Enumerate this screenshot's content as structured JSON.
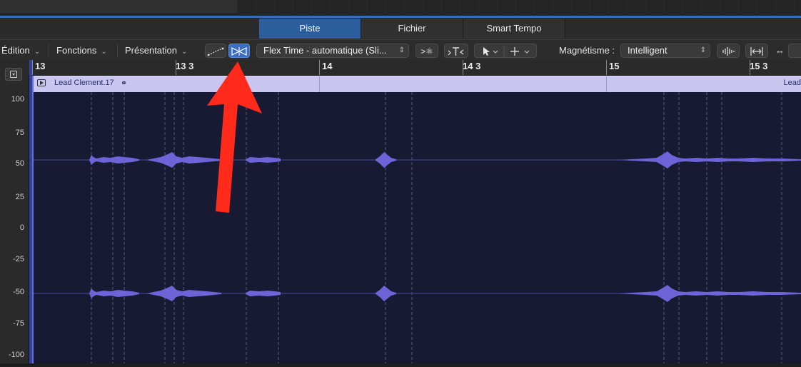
{
  "tabs": [
    "Piste",
    "Fichier",
    "Smart Tempo"
  ],
  "active_tab": "Piste",
  "toolbar": {
    "menus": [
      "Édition",
      "Fonctions",
      "Présentation"
    ],
    "flex_mode": "Flex Time - automatique (Sli...",
    "snap_label": "Magnétisme :",
    "snap_value": "Intelligent"
  },
  "ruler": {
    "labels": [
      "13",
      "13 3",
      "14",
      "14 3",
      "15",
      "15 3"
    ]
  },
  "region": {
    "name": "Lead Clement.17",
    "name_next": "Lead"
  },
  "amplitude_axis": {
    "labels": [
      "100",
      "75",
      "50",
      "25",
      "0",
      "-25",
      "-50",
      "-75",
      "-100"
    ]
  },
  "colors": {
    "accent": "#3b6ec0",
    "active_tab": "#2b5e9c",
    "waveform": "#6f63d8",
    "region_header": "#c9c7f0",
    "annotation_arrow": "#ff2a1a"
  },
  "icons": [
    "collapse-icon",
    "curve-icon",
    "flex-icon",
    "palette-icon",
    "catch-icon",
    "pointer-tool-icon",
    "crosshair-tool-icon",
    "waveform-zoom-icon",
    "fit-icon",
    "resize-icon",
    "play-icon",
    "loop-icon"
  ]
}
